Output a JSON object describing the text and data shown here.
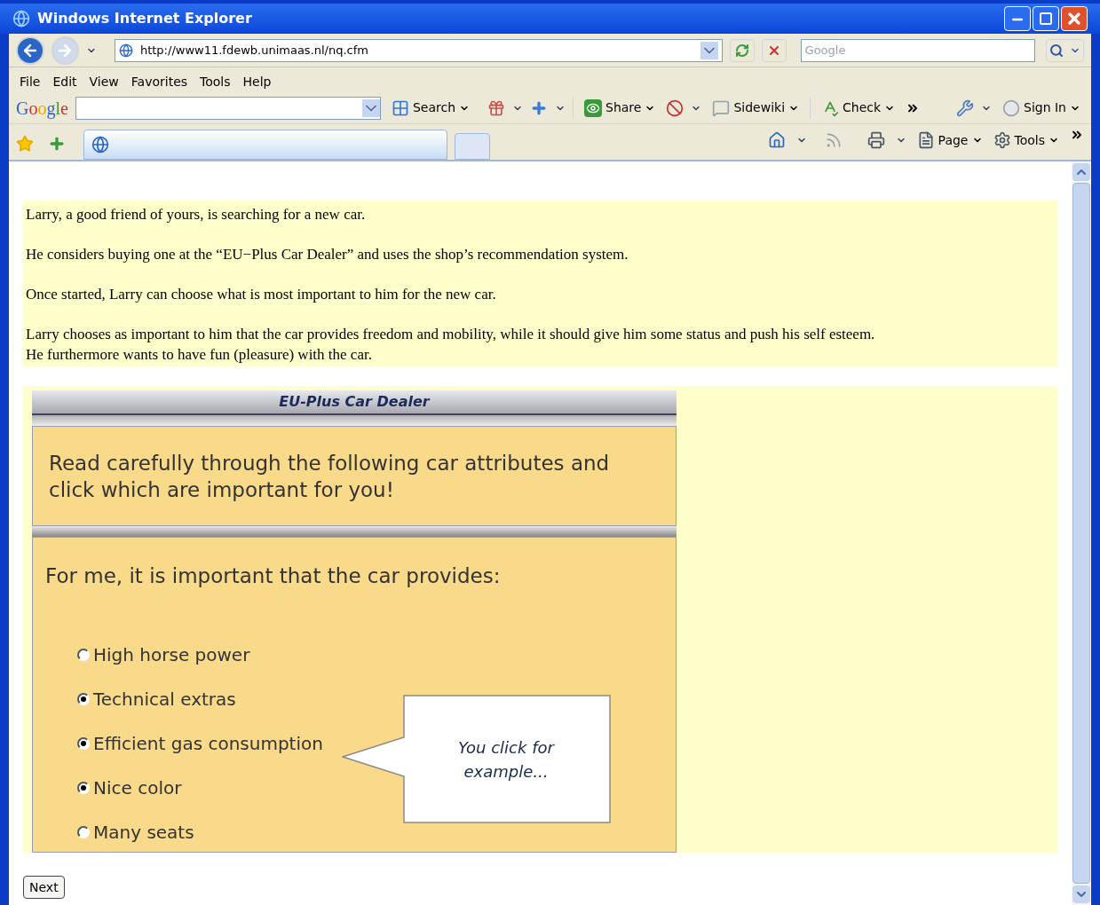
{
  "window": {
    "title": "Windows Internet Explorer"
  },
  "address_bar": {
    "url": "http://www11.fdewb.unimaas.nl/nq.cfm"
  },
  "search_box": {
    "placeholder": "Google"
  },
  "menu": [
    "File",
    "Edit",
    "View",
    "Favorites",
    "Tools",
    "Help"
  ],
  "google_toolbar": {
    "logo": "Google",
    "buttons": [
      {
        "kind": "search",
        "label": "Search"
      },
      {
        "kind": "share",
        "label": "Share"
      },
      {
        "kind": "sidewiki",
        "label": "Sidewiki"
      },
      {
        "kind": "check",
        "label": "Check"
      },
      {
        "kind": "sign-in",
        "label": "Sign In"
      }
    ]
  },
  "command_bar": {
    "buttons": [
      {
        "kind": "page",
        "label": "Page"
      },
      {
        "kind": "tools",
        "label": "Tools"
      }
    ]
  },
  "intro": {
    "paragraphs": [
      {
        "lines": [
          "Larry, a good friend of yours, is searching for a new car."
        ]
      },
      {
        "lines": [
          "He considers buying one at the “EU−Plus Car Dealer” and uses the shop’s recommendation system."
        ]
      },
      {
        "lines": [
          "Once started, Larry can choose what is most important to him for the new car."
        ]
      },
      {
        "lines": [
          "Larry chooses as important to him that the car provides freedom and mobility, while it should give him some status and push his self esteem.",
          "He furthermore wants to have fun (pleasure) with the car."
        ]
      }
    ]
  },
  "dealer": {
    "header": "EU-Plus Car Dealer",
    "instruction": "Read carefully through the following car attributes and click which are important for you!",
    "question": "For me, it is important that the car provides:",
    "options": [
      {
        "label": "High horse power",
        "checked": false
      },
      {
        "label": "Technical extras",
        "checked": true
      },
      {
        "label": "Efficient gas consumption",
        "checked": true
      },
      {
        "label": "Nice color",
        "checked": true
      },
      {
        "label": "Many seats",
        "checked": false
      }
    ],
    "callout": "You click for example..."
  },
  "next_button": "Next"
}
